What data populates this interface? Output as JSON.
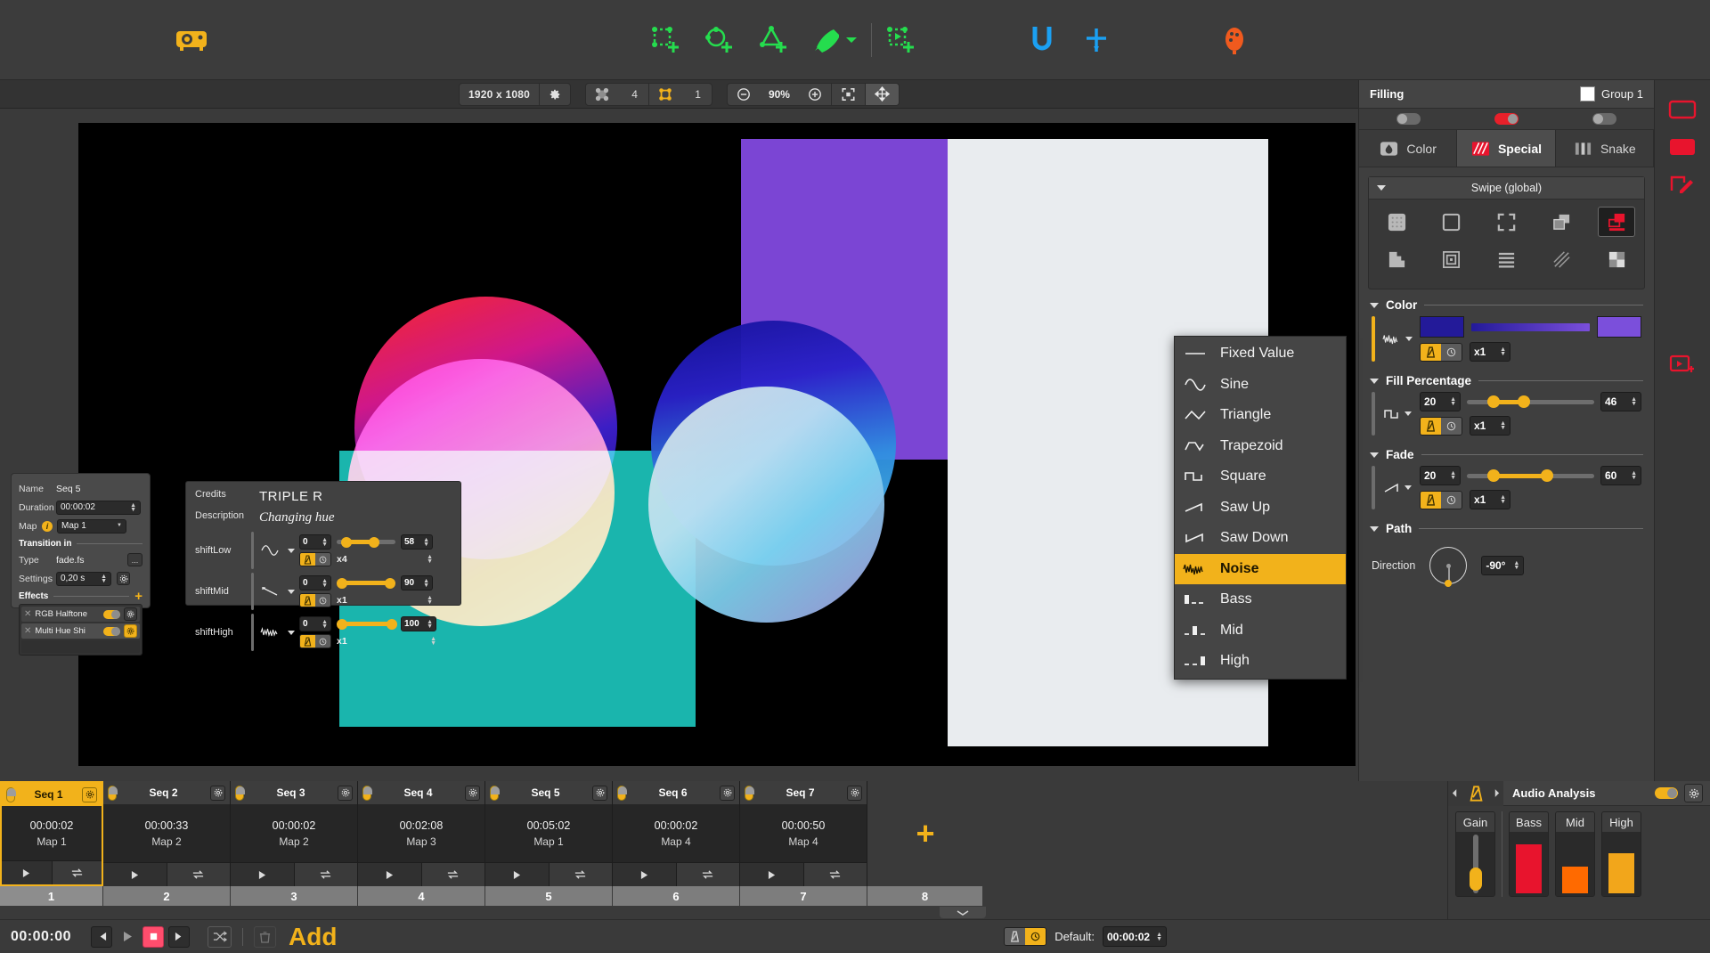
{
  "toolbar": {
    "icons": [
      {
        "name": "projector-icon",
        "label": "Projector"
      },
      {
        "name": "add-quad-icon",
        "label": "Add Quad"
      },
      {
        "name": "add-circle-icon",
        "label": "Add Circle"
      },
      {
        "name": "add-triangle-icon",
        "label": "Add Triangle"
      },
      {
        "name": "pen-tool-icon",
        "label": "Pen Tool"
      },
      {
        "name": "add-media-icon",
        "label": "Add Media"
      },
      {
        "name": "magnet-icon",
        "label": "Snap"
      },
      {
        "name": "crosshair-icon",
        "label": "Center"
      },
      {
        "name": "palette-icon",
        "label": "Palette"
      }
    ]
  },
  "viewbar": {
    "resolution": "1920 x 1080",
    "gear_label": "settings-gear",
    "shape_count": "4",
    "selected_count": "1",
    "zoom": "90%",
    "zoom_out_label": "Zoom out",
    "zoom_in_label": "Zoom in",
    "fit_label": "Fit to view",
    "pan_label": "Pan"
  },
  "sequence_properties": {
    "name_label": "Name",
    "name_value": "Seq 5",
    "duration_label": "Duration",
    "duration_value": "00:00:02",
    "map_label": "Map",
    "map_value": "Map 1",
    "map_more": "...",
    "transition_in": "Transition in",
    "type_label": "Type",
    "type_value": "fade.fs",
    "settings_label": "Settings",
    "settings_value": "0,20 s",
    "effects_label": "Effects",
    "add_effect": "+",
    "effects": [
      {
        "name": "RGB Halftone",
        "enabled": true,
        "selected": false
      },
      {
        "name": "Multi Hue Shi",
        "enabled": true,
        "selected": true
      }
    ]
  },
  "shader_panel": {
    "credits_label": "Credits",
    "credits_value": "TRIPLE R",
    "description_label": "Description",
    "description_value": "Changing hue",
    "params": [
      {
        "name": "shiftLow",
        "wave": "sine",
        "min": "0",
        "max": "58",
        "mult": "x4",
        "fill_start": 12,
        "fill_end": 62
      },
      {
        "name": "shiftMid",
        "wave": "saw-down",
        "min": "0",
        "max": "90",
        "mult": "x1",
        "fill_start": 3,
        "fill_end": 96
      },
      {
        "name": "shiftHigh",
        "wave": "noise",
        "min": "0",
        "max": "100",
        "mult": "x1",
        "fill_start": 3,
        "fill_end": 100
      }
    ]
  },
  "waveform_menu": {
    "items": [
      {
        "label": "Fixed Value",
        "icon": "fixed-value-icon",
        "active": false
      },
      {
        "label": "Sine",
        "icon": "sine-icon",
        "active": false
      },
      {
        "label": "Triangle",
        "icon": "triangle-icon",
        "active": false
      },
      {
        "label": "Trapezoid",
        "icon": "trapezoid-icon",
        "active": false
      },
      {
        "label": "Square",
        "icon": "square-icon",
        "active": false
      },
      {
        "label": "Saw Up",
        "icon": "saw-up-icon",
        "active": false
      },
      {
        "label": "Saw Down",
        "icon": "saw-down-icon",
        "active": false
      },
      {
        "label": "Noise",
        "icon": "noise-icon",
        "active": true
      },
      {
        "label": "Bass",
        "icon": "bass-icon",
        "active": false
      },
      {
        "label": "Mid",
        "icon": "mid-icon",
        "active": false
      },
      {
        "label": "High",
        "icon": "high-icon",
        "active": false
      }
    ]
  },
  "right_panel": {
    "title": "Filling",
    "group_label": "Group 1",
    "tabs": [
      {
        "label": "Color",
        "icon": "droplet-icon",
        "active": false
      },
      {
        "label": "Special",
        "icon": "special-icon",
        "active": true
      },
      {
        "label": "Snake",
        "icon": "snake-icon",
        "active": false
      }
    ],
    "mode_toggles": [
      {
        "name": "toggle-left",
        "on": false
      },
      {
        "name": "toggle-center",
        "on": true
      },
      {
        "name": "toggle-right",
        "on": false
      }
    ],
    "swipe": {
      "title": "Swipe (global)",
      "icons_row1": [
        "dots-fill-icon",
        "outline-square-icon",
        "expand-icon",
        "layers-icon",
        "swipe-icon"
      ],
      "icons_row2": [
        "stairs-icon",
        "concentric-icon",
        "lines-icon",
        "hatch-icon",
        "checker-icon"
      ],
      "selected_index": 4
    },
    "color": {
      "title": "Color",
      "wave": "noise",
      "from_color": "#231a99",
      "to_color": "#7b4fdb",
      "mult": "x1"
    },
    "fill_percentage": {
      "title": "Fill Percentage",
      "wave": "square",
      "min": "20",
      "max": "46",
      "mult": "x1",
      "fill_start": 18,
      "fill_end": 48
    },
    "fade": {
      "title": "Fade",
      "wave": "saw-up",
      "min": "20",
      "max": "60",
      "mult": "x1",
      "fill_start": 18,
      "fill_end": 64
    },
    "path": {
      "title": "Path",
      "direction_label": "Direction",
      "direction_value": "-90°"
    }
  },
  "right_strip": {
    "buttons": [
      {
        "name": "outline-rect-icon"
      },
      {
        "name": "filled-rect-icon"
      },
      {
        "name": "edit-shape-icon"
      },
      {
        "name": "media-panel-icon"
      }
    ]
  },
  "timeline": {
    "sequences": [
      {
        "name": "Seq 1",
        "duration": "00:00:02",
        "map": "Map 1",
        "index": "1",
        "selected": true
      },
      {
        "name": "Seq 2",
        "duration": "00:00:33",
        "map": "Map 2",
        "index": "2",
        "selected": false
      },
      {
        "name": "Seq 3",
        "duration": "00:00:02",
        "map": "Map 2",
        "index": "3",
        "selected": false
      },
      {
        "name": "Seq 4",
        "duration": "00:02:08",
        "map": "Map 3",
        "index": "4",
        "selected": false
      },
      {
        "name": "Seq 5",
        "duration": "00:05:02",
        "map": "Map 1",
        "index": "5",
        "selected": false
      },
      {
        "name": "Seq 6",
        "duration": "00:00:02",
        "map": "Map 4",
        "index": "6",
        "selected": false
      },
      {
        "name": "Seq 7",
        "duration": "00:00:50",
        "map": "Map 4",
        "index": "7",
        "selected": false
      }
    ],
    "add_label": "+",
    "add_index": "8"
  },
  "audio_analysis": {
    "title": "Audio Analysis",
    "enabled": true,
    "meters": [
      {
        "label": "Gain",
        "type": "slider",
        "value": 22,
        "color": "#f2b21b"
      },
      {
        "label": "Bass",
        "type": "bar",
        "value": 76,
        "color": "#e8142d"
      },
      {
        "label": "Mid",
        "type": "bar",
        "value": 41,
        "color": "#ff6a00"
      },
      {
        "label": "High",
        "type": "bar",
        "value": 62,
        "color": "#f2a61b"
      }
    ]
  },
  "transport": {
    "timecode": "00:00:00",
    "prev_label": "Previous",
    "play_label": "Play",
    "stop_label": "Stop",
    "next_label": "Next",
    "shuffle_label": "Shuffle",
    "delete_label": "Delete",
    "add_label": "Add",
    "default_label": "Default:",
    "default_value": "00:00:02"
  }
}
